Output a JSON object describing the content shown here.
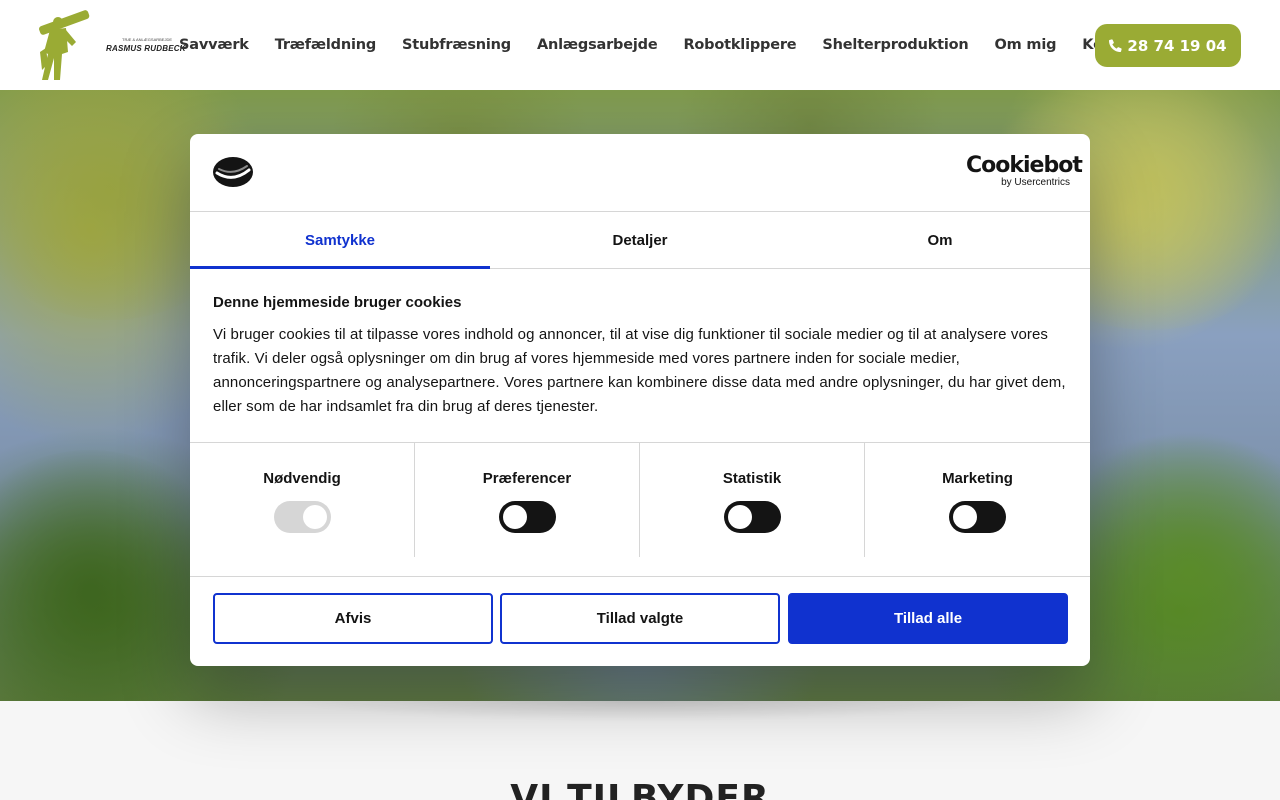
{
  "site": {
    "logo_name": "RASMUS RUDBECK",
    "logo_tagline": "TRÆ & ANLÆGSARBEJDE",
    "nav": [
      {
        "label": "Savværk"
      },
      {
        "label": "Træfældning"
      },
      {
        "label": "Stubfræsning"
      },
      {
        "label": "Anlægsarbejde"
      },
      {
        "label": "Robotklippere"
      },
      {
        "label": "Shelterproduktion"
      },
      {
        "label": "Om mig"
      },
      {
        "label": "Kontakt"
      }
    ],
    "phone_label": "28 74 19 04",
    "section_title": "VI TILBYDER",
    "accent_color": "#9aab34"
  },
  "cookie_dialog": {
    "brand_main": "Cookiebot",
    "brand_sub": "by Usercentrics",
    "tabs": [
      {
        "label": "Samtykke",
        "active": true
      },
      {
        "label": "Detaljer",
        "active": false
      },
      {
        "label": "Om",
        "active": false
      }
    ],
    "title": "Denne hjemmeside bruger cookies",
    "body": "Vi bruger cookies til at tilpasse vores indhold og annoncer, til at vise dig funktioner til sociale medier og til at analysere vores trafik. Vi deler også oplysninger om din brug af vores hjemmeside med vores partnere inden for sociale medier, annonceringspartnere og analysepartnere. Vores partnere kan kombinere disse data med andre oplysninger, du har givet dem, eller som de har indsamlet fra din brug af deres tjenester.",
    "categories": [
      {
        "label": "Nødvendig",
        "enabled": true,
        "locked": true
      },
      {
        "label": "Præferencer",
        "enabled": false,
        "locked": false
      },
      {
        "label": "Statistik",
        "enabled": false,
        "locked": false
      },
      {
        "label": "Marketing",
        "enabled": false,
        "locked": false
      }
    ],
    "buttons": {
      "deny": "Afvis",
      "allow_selected": "Tillad valgte",
      "allow_all": "Tillad alle"
    },
    "accent_color": "#1032cf"
  }
}
